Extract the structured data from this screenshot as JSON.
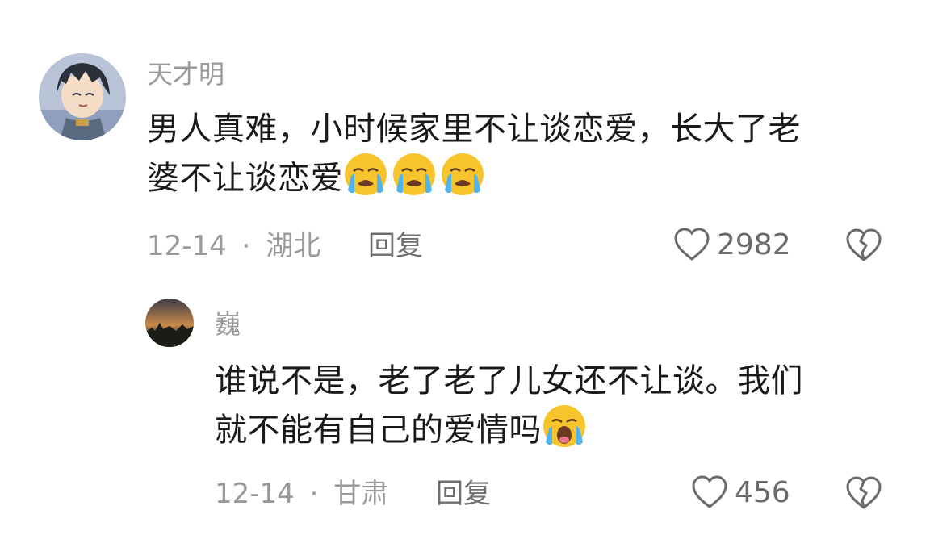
{
  "comments": [
    {
      "username": "天才明",
      "text_line1": "男人真难，小时候家里不让谈恋爱，长大了老",
      "text_line2": "婆不让谈恋爱",
      "emojis": [
        "loudly-crying-face",
        "loudly-crying-face",
        "loudly-crying-face"
      ],
      "date": "12-14",
      "separator": "·",
      "location": "湖北",
      "reply_label": "回复",
      "likes": "2982"
    },
    {
      "username": "巍",
      "text_line1": "谁说不是，老了老了儿女还不让谈。我们",
      "text_line2": "就不能有自己的爱情吗",
      "emojis": [
        "crying-face-open-mouth"
      ],
      "date": "12-14",
      "separator": "·",
      "location": "甘肃",
      "reply_label": "回复",
      "likes": "456"
    }
  ],
  "colors": {
    "meta_gray": "#9a9a9a",
    "text": "#1a1a1a",
    "emoji_yellow": "#f7c52b",
    "tear_blue": "#4fb3f0"
  }
}
